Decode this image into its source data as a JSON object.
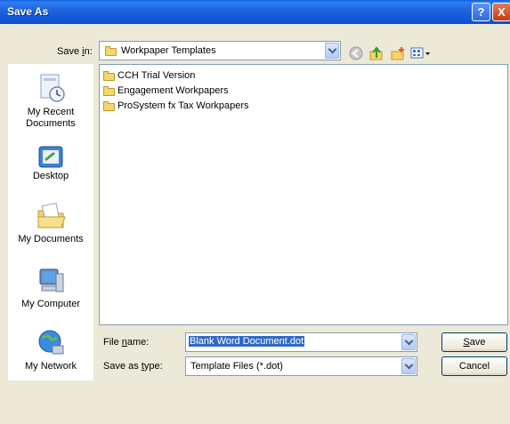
{
  "title": "Save As",
  "title_buttons": {
    "help": "?",
    "close": "X"
  },
  "save_in": {
    "label_prefix": "Save ",
    "label_access": "i",
    "label_suffix": "n:",
    "value": "Workpaper Templates"
  },
  "places": [
    {
      "line1": "My Recent",
      "line2": "Documents",
      "icon": "recent-documents-icon"
    },
    {
      "line1": "Desktop",
      "line2": "",
      "icon": "desktop-icon"
    },
    {
      "line1": "My Documents",
      "line2": "",
      "icon": "my-documents-icon"
    },
    {
      "line1": "My Computer",
      "line2": "",
      "icon": "my-computer-icon"
    },
    {
      "line1": "My Network",
      "line2": "",
      "icon": "my-network-icon"
    }
  ],
  "files": [
    {
      "name": "CCH Trial Version"
    },
    {
      "name": "Engagement Workpapers"
    },
    {
      "name": "ProSystem fx Tax Workpapers"
    }
  ],
  "file_name": {
    "label_prefix": "File ",
    "label_access": "n",
    "label_suffix": "ame:",
    "value": "Blank Word Document.dot"
  },
  "save_as_type": {
    "label_prefix": "Save as ",
    "label_access": "t",
    "label_suffix": "ype:",
    "value": "Template Files (*.dot)"
  },
  "buttons": {
    "save_access": "S",
    "save_rest": "ave",
    "cancel": "Cancel"
  },
  "colors": {
    "title_bar": "#0b4fd3",
    "selection": "#316ac5",
    "folder": "#f3d66d"
  }
}
